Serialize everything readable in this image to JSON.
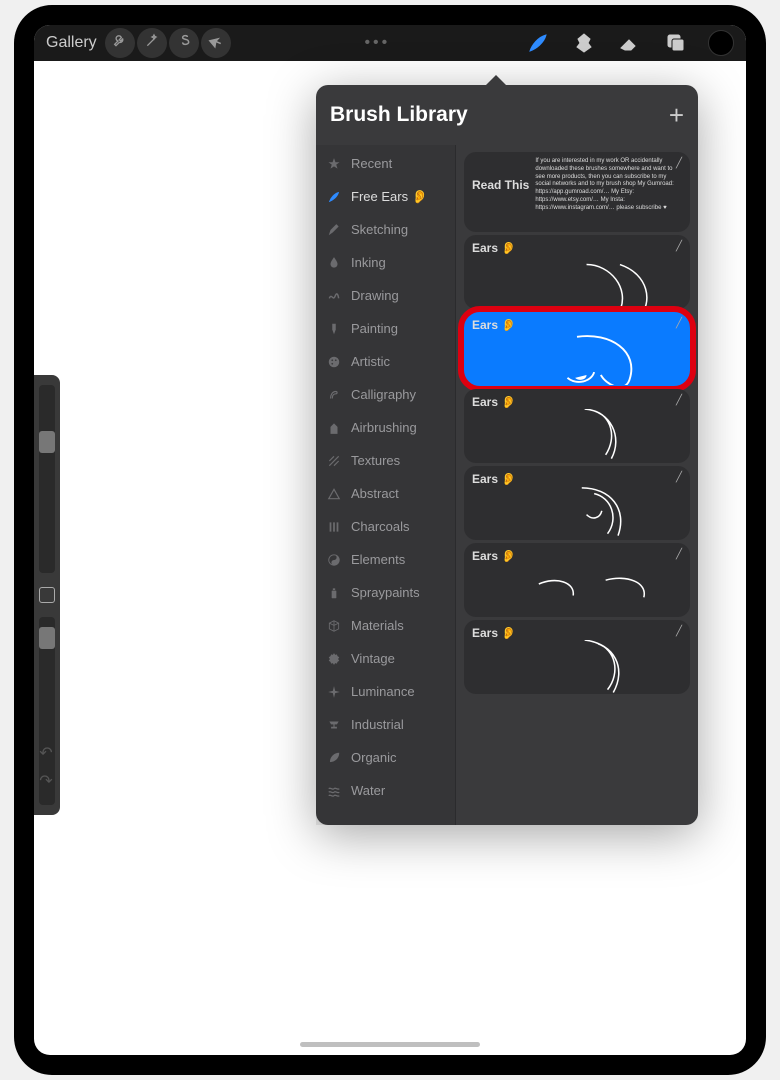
{
  "toolbar": {
    "gallery_label": "Gallery",
    "ellipsis": "•••",
    "actions_icons": [
      "wrench",
      "wand",
      "s-curve",
      "cursor"
    ],
    "right_tools": [
      "brush",
      "smudge",
      "eraser",
      "layers",
      "color"
    ]
  },
  "panel": {
    "title": "Brush Library",
    "add_icon": "+"
  },
  "categories": [
    {
      "icon": "star",
      "label": "Recent"
    },
    {
      "icon": "brush",
      "label": "Free Ears 👂",
      "selected": true
    },
    {
      "icon": "pencil",
      "label": "Sketching"
    },
    {
      "icon": "drop",
      "label": "Inking"
    },
    {
      "icon": "squiggle",
      "label": "Drawing"
    },
    {
      "icon": "paintbrush",
      "label": "Painting"
    },
    {
      "icon": "palette",
      "label": "Artistic"
    },
    {
      "icon": "calli",
      "label": "Calligraphy"
    },
    {
      "icon": "spray",
      "label": "Airbrushing"
    },
    {
      "icon": "hatch",
      "label": "Textures"
    },
    {
      "icon": "triangle",
      "label": "Abstract"
    },
    {
      "icon": "bars",
      "label": "Charcoals"
    },
    {
      "icon": "yinyang",
      "label": "Elements"
    },
    {
      "icon": "spraycan",
      "label": "Spraypaints"
    },
    {
      "icon": "cube",
      "label": "Materials"
    },
    {
      "icon": "gear",
      "label": "Vintage"
    },
    {
      "icon": "sparkle",
      "label": "Luminance"
    },
    {
      "icon": "anvil",
      "label": "Industrial"
    },
    {
      "icon": "leaf",
      "label": "Organic"
    },
    {
      "icon": "waves",
      "label": "Water"
    }
  ],
  "brushes": [
    {
      "name": "Read This",
      "note": "If you are interested in my work OR accidentally downloaded these brushes somewhere and want to see more products, then you can subscribe to my social networks and to my brush shop My Gumroad: https://app.gumroad.com/… My Etsy: https://www.etsy.com/… My Insta: https://www.instagram.com/… please subscribe ♥",
      "type": "info"
    },
    {
      "name": "Ears 👂",
      "type": "ear",
      "variant": 1
    },
    {
      "name": "Ears 👂",
      "type": "ear",
      "variant": 2,
      "selected": true,
      "highlighted": true
    },
    {
      "name": "Ears 👂",
      "type": "ear",
      "variant": 3
    },
    {
      "name": "Ears 👂",
      "type": "ear",
      "variant": 4
    },
    {
      "name": "Ears 👂",
      "type": "ear",
      "variant": 5
    },
    {
      "name": "Ears 👂",
      "type": "ear",
      "variant": 6
    }
  ],
  "colors": {
    "accent": "#0a7bff",
    "highlight_ring": "#dd0010"
  }
}
